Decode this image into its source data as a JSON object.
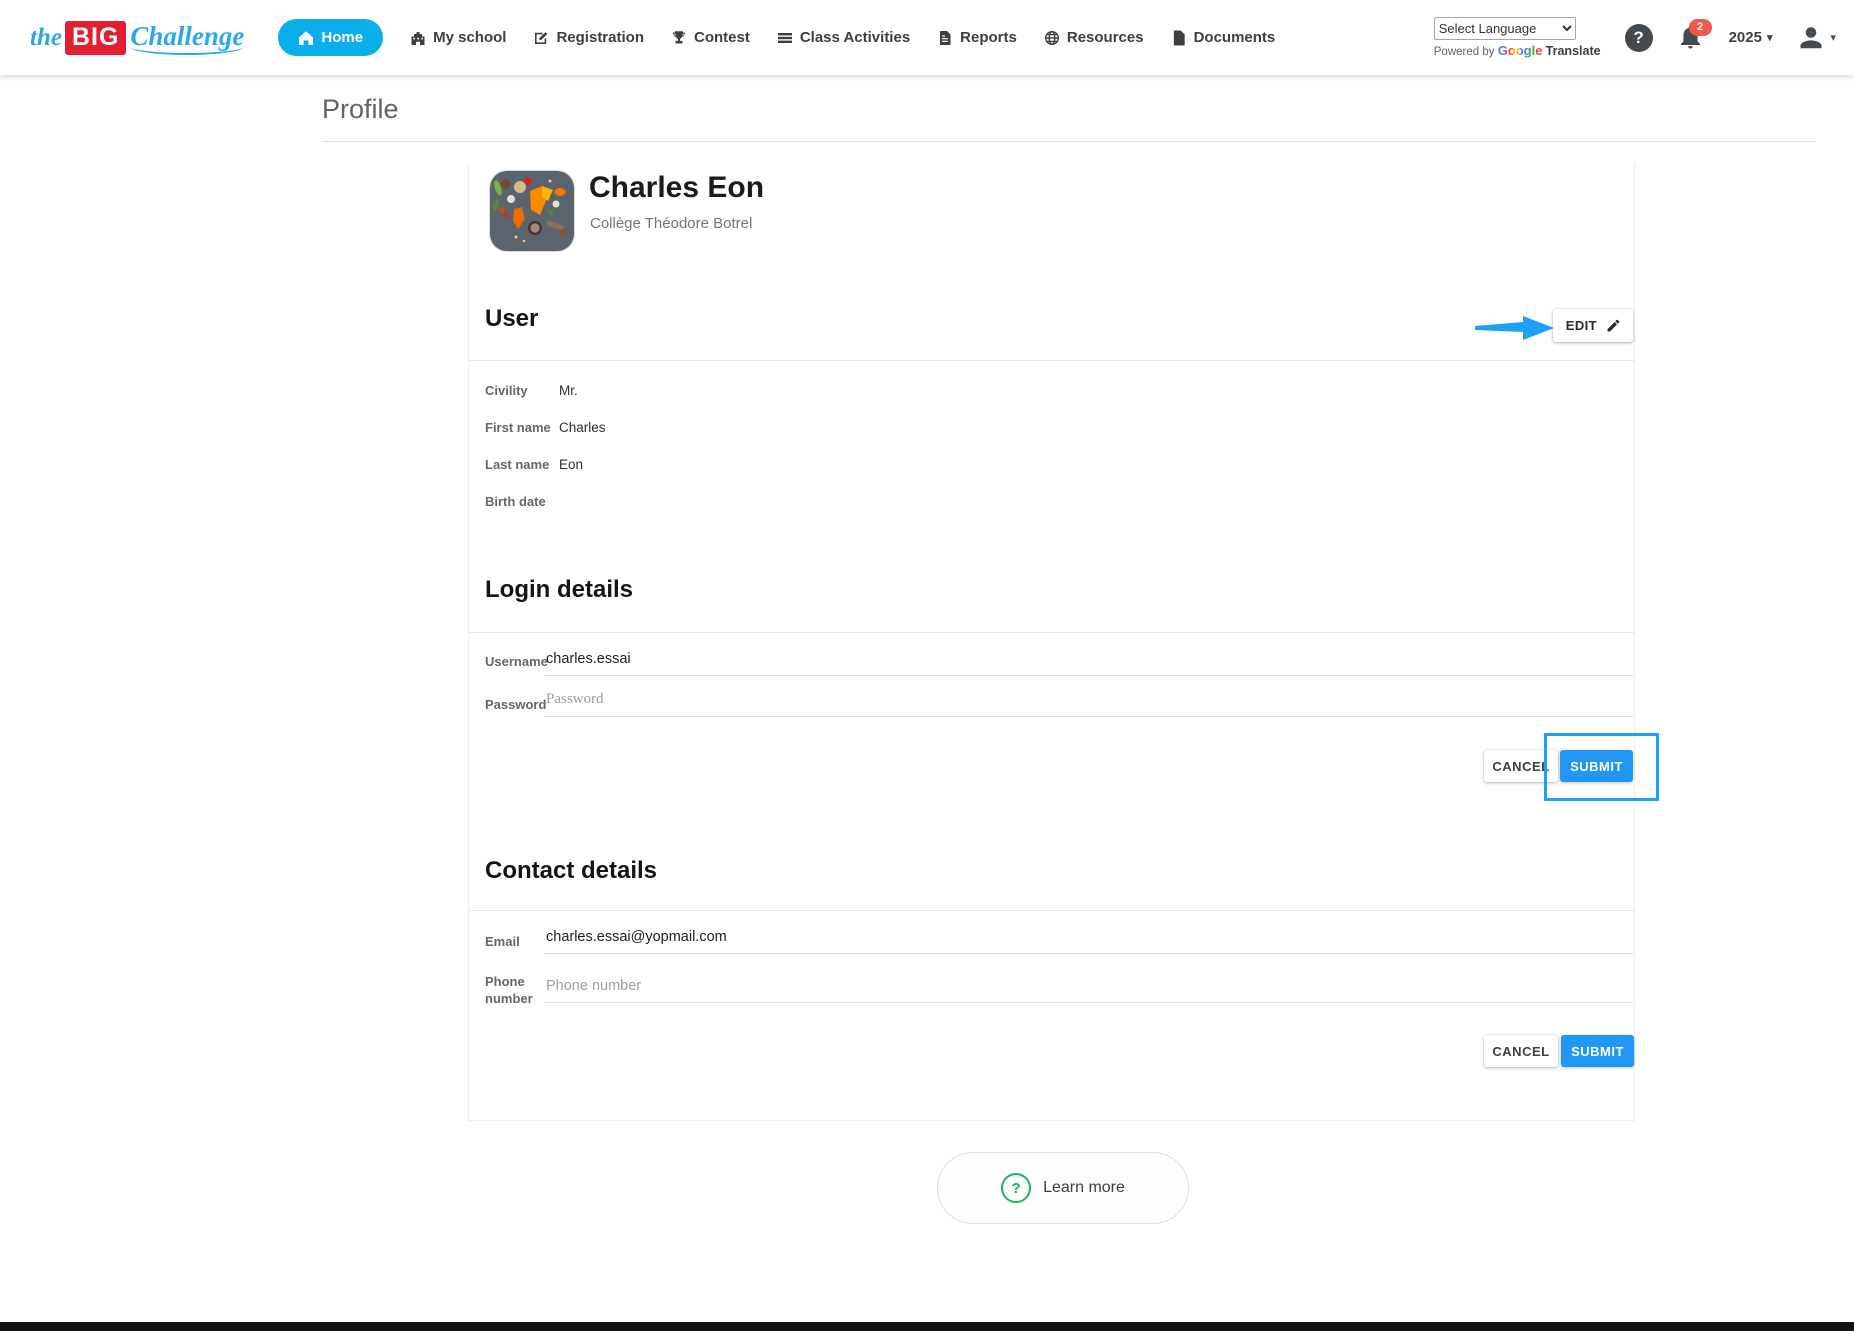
{
  "colors": {
    "home_pill": "#0baee8",
    "logo_red": "#e41e31",
    "logo_blue": "#29abe2",
    "accent_blue": "#2196f3",
    "annotation_blue": "#1da1f0",
    "badge_red": "#f1584d",
    "learn_more_green": "#12b76a",
    "footer_dark": "#111111"
  },
  "header": {
    "logo": {
      "the": "the",
      "big": "BIG",
      "challenge": "Challenge"
    },
    "nav": [
      {
        "label": "Home",
        "active": true
      },
      {
        "label": "My school",
        "active": false
      },
      {
        "label": "Registration",
        "active": false
      },
      {
        "label": "Contest",
        "active": false
      },
      {
        "label": "Class Activities",
        "active": false
      },
      {
        "label": "Reports",
        "active": false
      },
      {
        "label": "Resources",
        "active": false
      },
      {
        "label": "Documents",
        "active": false
      }
    ],
    "language_select": {
      "value": "Select Language"
    },
    "powered_by": {
      "prefix": "Powered by",
      "google": "Google",
      "translate": "Translate"
    },
    "help_glyph": "?",
    "notification_count": "2",
    "year": "2025",
    "caret_glyph": "▾"
  },
  "page": {
    "title": "Profile"
  },
  "profile": {
    "name": "Charles Eon",
    "school": "Collège Théodore Botrel"
  },
  "user_section": {
    "title": "User",
    "edit_label": "EDIT",
    "fields": [
      {
        "label": "Civility",
        "value": "Mr."
      },
      {
        "label": "First name",
        "value": "Charles"
      },
      {
        "label": "Last name",
        "value": "Eon"
      },
      {
        "label": "Birth date",
        "value": ""
      }
    ]
  },
  "login_section": {
    "title": "Login details",
    "username_label": "Username",
    "username_value": "charles.essai",
    "password_label": "Password",
    "password_placeholder": "Password",
    "cancel_label": "CANCEL",
    "submit_label": "SUBMIT"
  },
  "contact_section": {
    "title": "Contact details",
    "email_label": "Email",
    "email_value": "charles.essai@yopmail.com",
    "phone_label": "Phone number",
    "phone_placeholder": "Phone number",
    "cancel_label": "CANCEL",
    "submit_label": "SUBMIT"
  },
  "learn_more": {
    "label": "Learn more",
    "icon_glyph": "?"
  }
}
